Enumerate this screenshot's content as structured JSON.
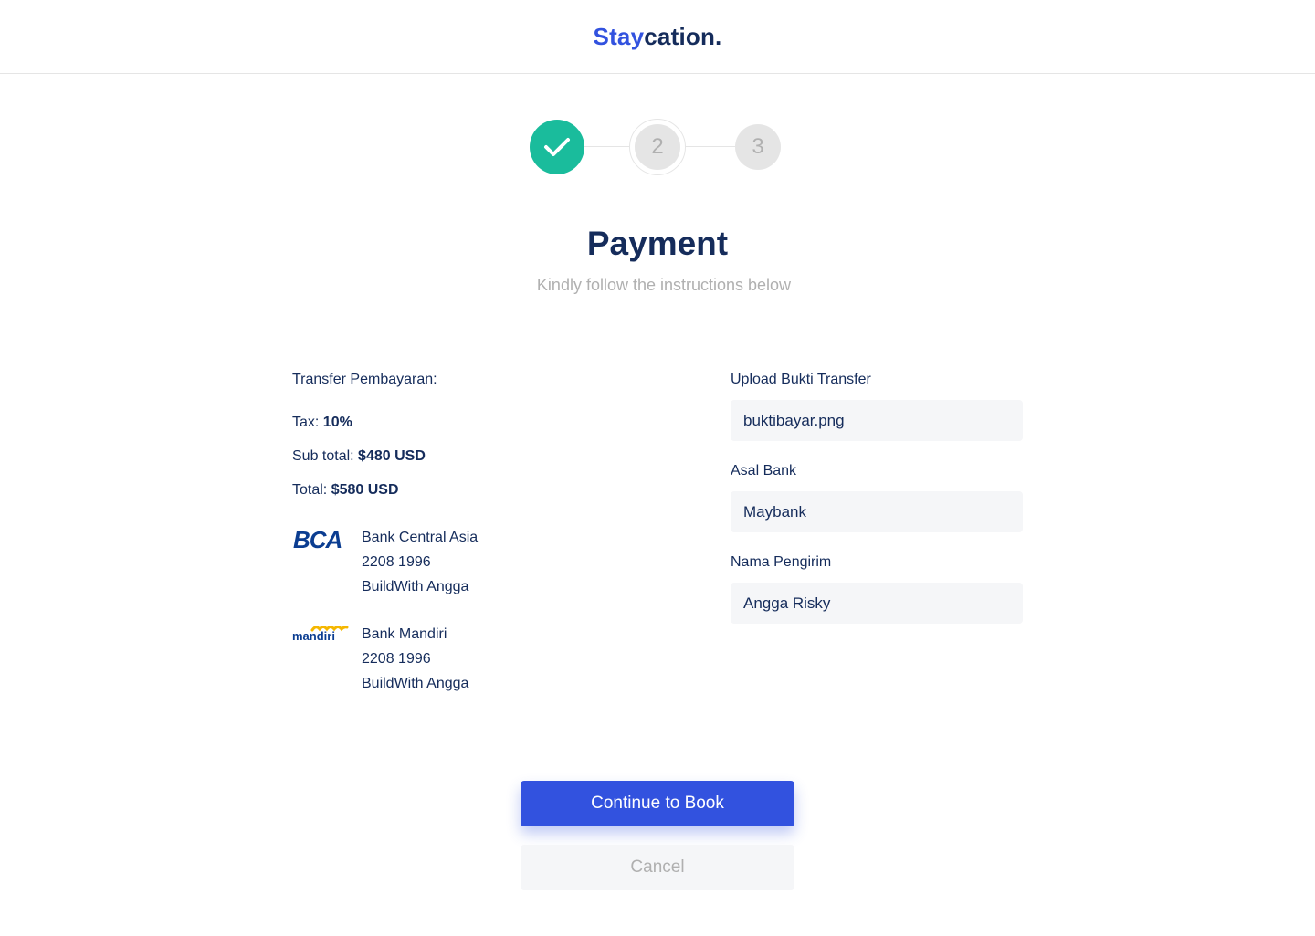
{
  "brand": {
    "part1": "Stay",
    "part2": "cation."
  },
  "stepper": {
    "steps": [
      {
        "label": "",
        "state": "done"
      },
      {
        "label": "2",
        "state": "active"
      },
      {
        "label": "3",
        "state": "upcoming"
      }
    ]
  },
  "title": "Payment",
  "subtitle": "Kindly follow the instructions below",
  "payment": {
    "heading": "Transfer Pembayaran:",
    "tax_label": "Tax: ",
    "tax_value": "10%",
    "subtotal_label": "Sub total: ",
    "subtotal_value": "$480 USD",
    "total_label": "Total: ",
    "total_value": "$580 USD",
    "banks": [
      {
        "logo_text": "BCA",
        "name": "Bank Central Asia",
        "account": "2208 1996",
        "holder": "BuildWith Angga"
      },
      {
        "logo_text": "mandiri",
        "name": "Bank Mandiri",
        "account": "2208 1996",
        "holder": "BuildWith Angga"
      }
    ]
  },
  "form": {
    "upload_label": "Upload Bukti Transfer",
    "upload_value": "buktibayar.png",
    "bank_label": "Asal Bank",
    "bank_value": "Maybank",
    "sender_label": "Nama Pengirim",
    "sender_value": "Angga Risky"
  },
  "buttons": {
    "continue": "Continue to Book",
    "cancel": "Cancel"
  },
  "colors": {
    "primary": "#3252df",
    "navy": "#152c5b",
    "success": "#1abc9c",
    "muted": "#b0b0b0",
    "input_bg": "#f5f6f8",
    "mandiri_yellow": "#f5b700",
    "mandiri_blue": "#0b3d91"
  }
}
